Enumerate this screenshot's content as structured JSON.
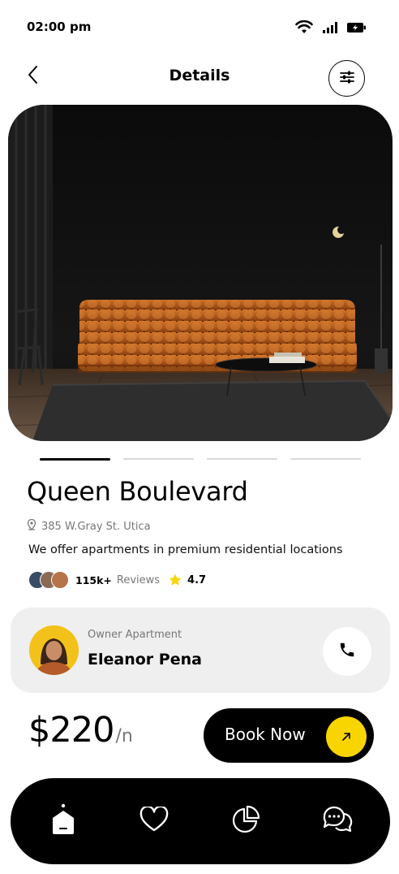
{
  "status": {
    "time": "02:00 pm"
  },
  "header": {
    "title": "Details"
  },
  "gallery": {
    "count": 4,
    "active_index": 0
  },
  "property": {
    "name": "Queen Boulevard",
    "address": "385 W.Gray St. Utica",
    "description": "We offer apartments in premium residential locations",
    "reviews_count": "115k+",
    "reviews_label": "Reviews",
    "rating": "4.7"
  },
  "owner": {
    "role": "Owner Apartment",
    "name": "Eleanor Pena"
  },
  "pricing": {
    "amount": "$220",
    "unit": "/n"
  },
  "actions": {
    "book_label": "Book Now"
  },
  "colors": {
    "accent": "#f8d500",
    "dark": "#000000",
    "card": "#efefef",
    "sofa": "#c8651c"
  },
  "nav": [
    "home-icon",
    "heart-icon",
    "pie-chart-icon",
    "chat-icon"
  ]
}
